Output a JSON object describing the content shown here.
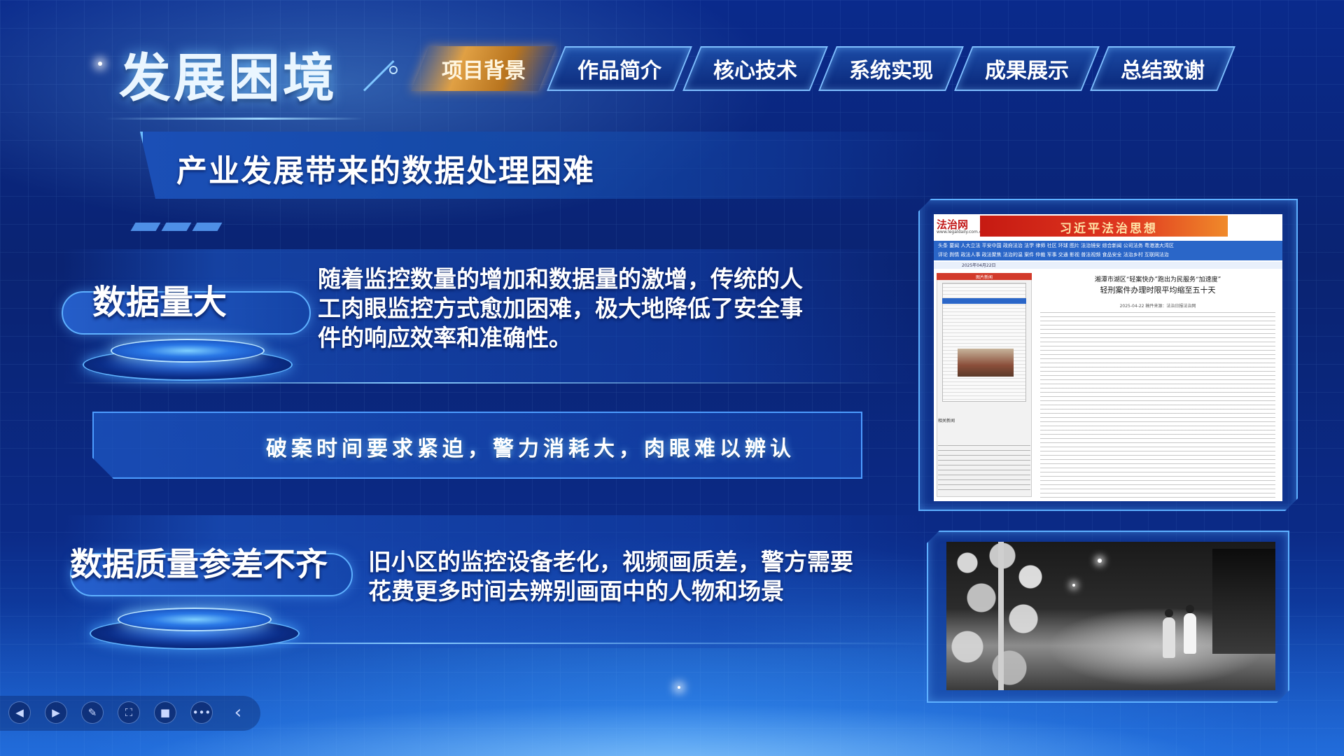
{
  "page": {
    "title": "发展困境",
    "subtitle": "产业发展带来的数据处理困难"
  },
  "nav": {
    "tabs": [
      {
        "label": "项目背景",
        "active": true
      },
      {
        "label": "作品简介",
        "active": false
      },
      {
        "label": "核心技术",
        "active": false
      },
      {
        "label": "系统实现",
        "active": false
      },
      {
        "label": "成果展示",
        "active": false
      },
      {
        "label": "总结致谢",
        "active": false
      }
    ]
  },
  "sections": [
    {
      "label": "数据量大",
      "text_lines": [
        "随着监控数量的增加和数据量的激增，传统的人",
        "工肉眼监控方式愈加困难，极大地降低了安全事",
        "件的响应效率和准确性。"
      ]
    },
    {
      "label": "数据质量参差不齐",
      "text_lines": [
        "旧小区的监控设备老化，视频画质差，警方需要",
        "花费更多时间去辨别画面中的人物和场景"
      ]
    }
  ],
  "note": "破案时间要求紧迫，警力消耗大，肉眼难以辨认",
  "news_screenshot": {
    "site_logo": "法治网",
    "site_domain": "www.legaldaily.com.cn",
    "banner": "习近平法治思想",
    "nav_row1": "头条  要闻  人大立法  平安中国  政府法治  法学  律师  社区  环球  图片  法治镜安  综合新闻  公司法务  粤港澳大湾区",
    "nav_row2": "评论  舆情  政法人事  政法聚焦  法治的温  案件  仲裁  军事  交通  影视  普法视频  食品安全  法治乡村  互联网法治",
    "date": "2025年04月22日",
    "section_header": "图片新闻",
    "headline_kicker": "湘潭市湖区“轻案快办”跑出为民服务“加速度”",
    "headline": "轻刑案件办理时限平均缩至五十天",
    "byline": "2025-04-22  稿件来源：法治日报法治网",
    "left_list_title": "相关新闻"
  },
  "controls": [
    {
      "name": "prev",
      "icon": "◀"
    },
    {
      "name": "next",
      "icon": "▶"
    },
    {
      "name": "pen",
      "icon": "✎"
    },
    {
      "name": "zoom",
      "icon": "⛶"
    },
    {
      "name": "camera",
      "icon": "■"
    },
    {
      "name": "more",
      "icon": "•••"
    },
    {
      "name": "collapse",
      "icon": "‹"
    }
  ],
  "colors": {
    "accent": "#5eb0ff",
    "active_tab": "#e0a044",
    "background": "#0a2372"
  }
}
